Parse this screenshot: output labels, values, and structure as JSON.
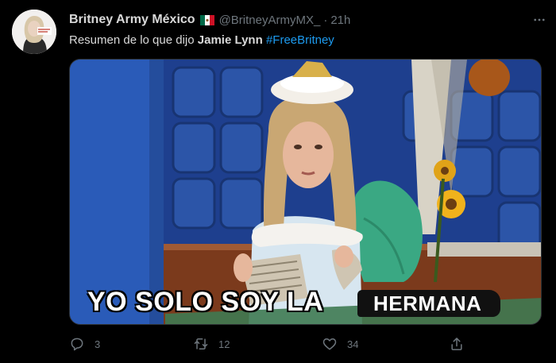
{
  "tweet": {
    "display_name": "Britney Army México",
    "handle": "@BritneyArmyMX_",
    "separator": "·",
    "time": "21h",
    "text_parts": {
      "lead": "Resumen de lo que dijo ",
      "bold": "Jamie Lynn",
      "hashtag": "#FreeBritney"
    },
    "avatar_icon": "britney-portrait-avatar",
    "flag_icon": "mexico-flag-icon",
    "media": {
      "caption_main": "YO SOLO SOY LA",
      "caption_box": "HERMANA"
    },
    "actions": {
      "reply_count": "3",
      "retweet_count": "12",
      "like_count": "34"
    }
  },
  "colors": {
    "background": "#000000",
    "text": "#d9d9d9",
    "muted": "#6e767d",
    "accent": "#1d9bf0"
  }
}
